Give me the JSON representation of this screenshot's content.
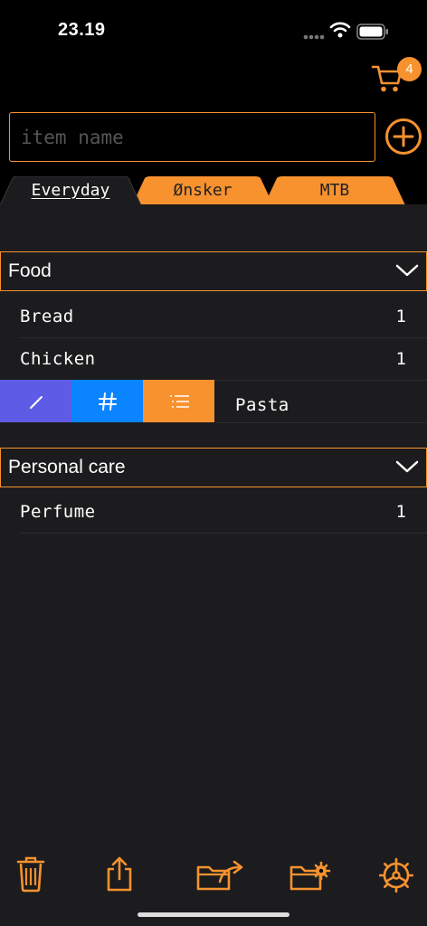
{
  "status_bar": {
    "time": "23.19"
  },
  "cart": {
    "badge_count": "4"
  },
  "input": {
    "placeholder": "item name",
    "value": ""
  },
  "tabs": [
    {
      "label": "Everyday",
      "active": true
    },
    {
      "label": "Ønsker",
      "active": false
    },
    {
      "label": "MTB",
      "active": false
    }
  ],
  "sections": [
    {
      "title": "Food",
      "items": [
        {
          "name": "Bread",
          "qty": "1"
        },
        {
          "name": "Chicken",
          "qty": "1"
        },
        {
          "name": "Pasta",
          "qty": ""
        }
      ]
    },
    {
      "title": "Personal care",
      "items": [
        {
          "name": "Perfume",
          "qty": "1"
        }
      ]
    }
  ],
  "swipe_actions": [
    {
      "icon": "pencil-icon",
      "color": "#5e5ce6"
    },
    {
      "icon": "hash-icon",
      "color": "#0a84ff",
      "label": "#"
    },
    {
      "icon": "list-icon",
      "color": "#f7922f"
    }
  ],
  "toolbar_icons": [
    "trash-icon",
    "share-icon",
    "folder-export-icon",
    "folder-settings-icon",
    "settings-gear-icon"
  ],
  "colors": {
    "accent": "#f7922f",
    "background": "#1c1c1e",
    "header_bg": "#000000"
  }
}
